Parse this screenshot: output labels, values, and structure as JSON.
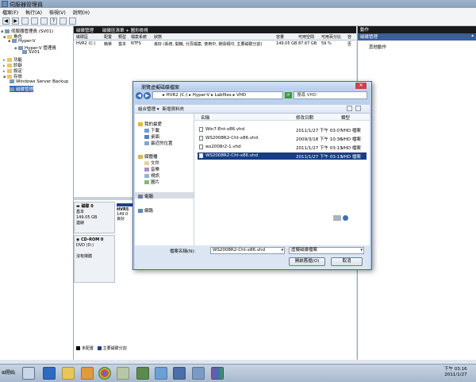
{
  "window": {
    "title": "伺服器管理員"
  },
  "menu": [
    "檔案(F)",
    "執行(A)",
    "檢視(V)",
    "說明(H)"
  ],
  "tree": [
    {
      "label": "伺服器管理員 (SV01)",
      "level": 0,
      "icon": "server-icon"
    },
    {
      "label": "角色",
      "level": 1,
      "icon": "folder-icon"
    },
    {
      "label": "Hyper-V",
      "level": 2,
      "icon": "hyperv-icon"
    },
    {
      "label": "Hyper-V 管理員",
      "level": 3,
      "icon": "hyperv-icon"
    },
    {
      "label": "SV01",
      "level": 4,
      "icon": "server-icon"
    },
    {
      "label": "功能",
      "level": 1,
      "icon": "folder-icon"
    },
    {
      "label": "診斷",
      "level": 1,
      "icon": "folder-icon"
    },
    {
      "label": "設定",
      "level": 1,
      "icon": "folder-icon"
    },
    {
      "label": "存放",
      "level": 1,
      "icon": "folder-icon"
    },
    {
      "label": "Windows Server Backup",
      "level": 2,
      "icon": "backup-icon"
    },
    {
      "label": "磁碟管理",
      "level": 2,
      "icon": "disk-icon",
      "selected": true
    }
  ],
  "center": {
    "tabs": [
      "磁碟管理",
      "磁碟區清單 + 圖形檢視"
    ],
    "columns": [
      "磁碟區",
      "配置",
      "類型",
      "檔案系統",
      "狀態",
      "容量",
      "可用空間",
      "可用百分比",
      "容"
    ],
    "row": [
      "HVR2 (C:)",
      "簡單",
      "基本",
      "NTFS",
      "良好 (系統, 開機, 分頁檔案, 使用中, 損毀傾印, 主要磁碟分割)",
      "149.05 GB",
      "87.67 GB",
      "59 %",
      "否"
    ],
    "disk0": {
      "name": "磁碟 0",
      "type": "基本",
      "size": "149.05 GB",
      "status": "連線",
      "part_name": "HVR5",
      "part_size": "149.0",
      "part_status": "良好"
    },
    "cdrom0": {
      "name": "CD-ROM 0",
      "type": "DVD (D:)",
      "status": "沒有媒體"
    },
    "legend": [
      {
        "label": "未配置",
        "color": "#000000"
      },
      {
        "label": "主要磁碟分割",
        "color": "#1f3d8c"
      }
    ]
  },
  "actions": {
    "header": "動作",
    "section": "磁碟管理",
    "more": "其他動作"
  },
  "dialog": {
    "title": "瀏覽虛擬磁碟檔案",
    "breadcrumb": "▸ HVR2 (C:) ▸ Hyper-V ▸ Labfiles ▸ VHD",
    "search": "搜尋 VHD",
    "toolbar": {
      "organize": "組合管理 ▾",
      "new_folder": "新增資料夾"
    },
    "nav": {
      "favorites": "我的最愛",
      "downloads": "下載",
      "desktop": "桌面",
      "recent": "最近的位置",
      "libraries": "媒體櫃",
      "documents": "文件",
      "music": "音樂",
      "videos": "視訊",
      "pictures": "圖片",
      "computer": "電腦",
      "network": "網路"
    },
    "columns": [
      "名稱",
      "修改日期",
      "類型"
    ],
    "files": [
      {
        "name": "Win7-Ent-x86.vhd",
        "date": "2011/1/27 下午 03:07",
        "type": "VHD 檔案"
      },
      {
        "name": "WS2008R2-Cht-x86.vhd",
        "date": "2009/3/18 下午 10:36",
        "type": "VHD 檔案"
      },
      {
        "name": "ws2008r2-1.vhd",
        "date": "2011/1/27 下午 03:13",
        "type": "VHD 檔案"
      },
      {
        "name": "WS2008R2-Cht-x86.vhd",
        "date": "2011/1/27 下午 03:13",
        "type": "VHD 檔案",
        "selected": true
      }
    ],
    "filename_label": "檔案名稱(N):",
    "filename_value": "WS2008R2-Cht-x86.vhd",
    "filetype_value": "虛擬磁碟檔案",
    "open": "開啟舊檔(O)",
    "cancel": "取消"
  },
  "taskbar": {
    "start": "開始",
    "time": "下午 03:16",
    "date": "2011/1/27"
  }
}
